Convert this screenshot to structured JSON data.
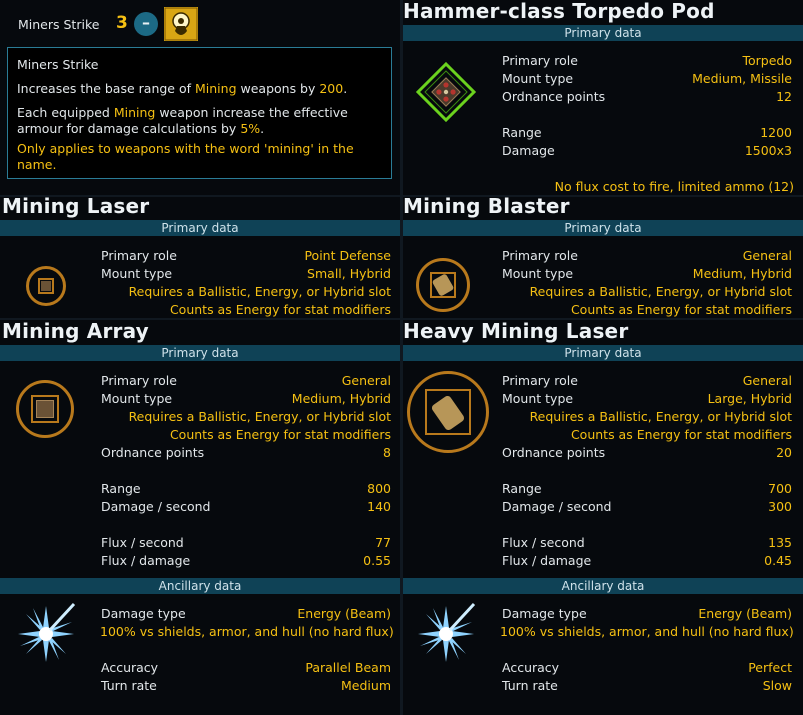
{
  "skill": {
    "name": "Miners Strike",
    "rank": "3",
    "minus_label": "–",
    "tooltip": {
      "title": "Miners Strike",
      "line1_a": "Increases the base range of ",
      "line1_hl": "Mining",
      "line1_b": " weapons by ",
      "line1_num": "200",
      "line1_end": ".",
      "line2_a": "Each equipped ",
      "line2_hl": "Mining",
      "line2_b": " weapon increase the effective",
      "line3_a": "armour for damage calculations by ",
      "line3_num": "5%",
      "line3_end": ".",
      "line4": "Only applies to weapons with the word 'mining' in the",
      "line5": "name."
    },
    "icon": "skill-hand-icon"
  },
  "torpedo": {
    "title": "Hammer-class Torpedo Pod",
    "section": "Primary data",
    "rows": [
      {
        "label": "Primary role",
        "value": "Torpedo"
      },
      {
        "label": "Mount type",
        "value": "Medium, Missile"
      },
      {
        "label": "Ordnance points",
        "value": "12"
      },
      {
        "label": "Range",
        "value": "1200"
      },
      {
        "label": "Damage",
        "value": "1500x3"
      }
    ],
    "note": "No flux cost to fire, limited ammo (12)",
    "icon": "torpedo-pod-icon"
  },
  "mining_laser": {
    "title": "Mining Laser",
    "section": "Primary data",
    "rows": [
      {
        "label": "Primary role",
        "value": "Point Defense"
      },
      {
        "label": "Mount type",
        "value": "Small, Hybrid"
      }
    ],
    "req": "Requires a Ballistic, Energy, or Hybrid slot",
    "counts": "Counts as Energy for stat modifiers",
    "icon": "mining-laser-icon"
  },
  "mining_blaster": {
    "title": "Mining Blaster",
    "section": "Primary data",
    "rows": [
      {
        "label": "Primary role",
        "value": "General"
      },
      {
        "label": "Mount type",
        "value": "Medium, Hybrid"
      }
    ],
    "req": "Requires a Ballistic, Energy, or Hybrid slot",
    "counts": "Counts as Energy for stat modifiers",
    "icon": "mining-blaster-icon"
  },
  "mining_array": {
    "title": "Mining Array",
    "section": "Primary data",
    "rows": [
      {
        "label": "Primary role",
        "value": "General"
      },
      {
        "label": "Mount type",
        "value": "Medium, Hybrid"
      }
    ],
    "req": "Requires a Ballistic, Energy, or Hybrid slot",
    "counts": "Counts as Energy for stat modifiers",
    "stats": [
      {
        "label": "Ordnance points",
        "value": "8"
      },
      {
        "label": "Range",
        "value": "800"
      },
      {
        "label": "Damage / second",
        "value": "140"
      },
      {
        "label": "Flux / second",
        "value": "77"
      },
      {
        "label": "Flux / damage",
        "value": "0.55"
      }
    ],
    "ancillary": {
      "section": "Ancillary data",
      "damage_type_label": "Damage type",
      "damage_type_value": "Energy (Beam)",
      "vs_note": "100% vs shields, armor, and hull (no hard flux)",
      "accuracy_label": "Accuracy",
      "accuracy_value": "Parallel Beam",
      "turn_label": "Turn rate",
      "turn_value": "Medium"
    },
    "icon": "mining-array-icon"
  },
  "heavy_mining_laser": {
    "title": "Heavy Mining Laser",
    "section": "Primary data",
    "rows": [
      {
        "label": "Primary role",
        "value": "General"
      },
      {
        "label": "Mount type",
        "value": "Large, Hybrid"
      }
    ],
    "req": "Requires a Ballistic, Energy, or Hybrid slot",
    "counts": "Counts as Energy for stat modifiers",
    "stats": [
      {
        "label": "Ordnance points",
        "value": "20"
      },
      {
        "label": "Range",
        "value": "700"
      },
      {
        "label": "Damage / second",
        "value": "300"
      },
      {
        "label": "Flux / second",
        "value": "135"
      },
      {
        "label": "Flux / damage",
        "value": "0.45"
      }
    ],
    "ancillary": {
      "section": "Ancillary data",
      "damage_type_label": "Damage type",
      "damage_type_value": "Energy (Beam)",
      "vs_note": "100% vs shields, armor, and hull (no hard flux)",
      "accuracy_label": "Accuracy",
      "accuracy_value": "Perfect",
      "turn_label": "Turn rate",
      "turn_value": "Slow"
    },
    "icon": "heavy-mining-laser-icon"
  }
}
